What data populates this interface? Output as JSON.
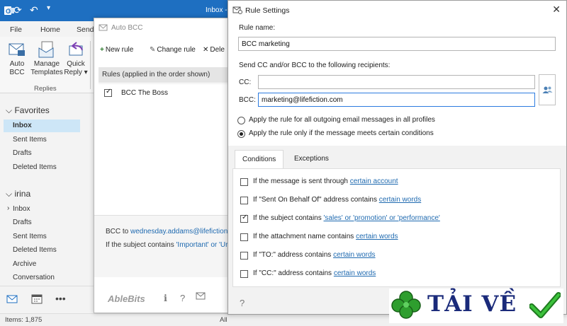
{
  "outlook": {
    "title": "Inbox -",
    "ribbon_tabs": [
      "File",
      "Home",
      "Send"
    ],
    "ribbon_buttons": {
      "auto_bcc": [
        "Auto",
        "BCC"
      ],
      "manage_templates": [
        "Manage",
        "Templates"
      ],
      "quick_reply": [
        "Quick",
        "Reply ▾"
      ]
    },
    "ribbon_group": "Replies",
    "favorites": {
      "header": "Favorites",
      "items": [
        "Inbox",
        "Sent Items",
        "Drafts",
        "Deleted Items"
      ]
    },
    "account": {
      "header": "irina",
      "items": [
        "Inbox",
        "Drafts",
        "Sent Items",
        "Deleted Items",
        "Archive",
        "Conversation"
      ]
    },
    "status": {
      "items": "Items: 1,875",
      "all": "All"
    }
  },
  "auto_bcc": {
    "title": "Auto BCC",
    "toolbar": {
      "new_rule": "New rule",
      "change_rule": "Change rule",
      "delete": "Dele"
    },
    "rules_header": "Rules (applied in the order shown)",
    "rules": [
      {
        "name": "BCC The Boss",
        "checked": true
      }
    ],
    "summary": {
      "line1_prefix": "BCC to ",
      "line1_value": "wednesday.addams@lifefiction.c",
      "line2_prefix": "If the subject contains ",
      "line2_value": "'Important' or 'Ur"
    },
    "logo": "AbleBits"
  },
  "rule_settings": {
    "title": "Rule Settings",
    "rule_name_label": "Rule name:",
    "rule_name_value": "BCC marketing",
    "send_label": "Send CC and/or BCC to the following recipients:",
    "cc_label": "CC:",
    "cc_value": "",
    "bcc_label": "BCC:",
    "bcc_value": "marketing@lifefiction.com",
    "radio_all": "Apply the rule for all outgoing email messages in all profiles",
    "radio_conditions": "Apply the rule only if the message meets certain conditions",
    "tabs": {
      "conditions": "Conditions",
      "exceptions": "Exceptions"
    },
    "conditions": [
      {
        "prefix": "If the message is sent through ",
        "link": "certain account",
        "checked": false
      },
      {
        "prefix": "If \"Sent On Behalf Of\" address contains ",
        "link": "certain words",
        "checked": false
      },
      {
        "prefix": "If the subject contains ",
        "link": "'sales' or 'promotion' or 'performance'",
        "checked": true
      },
      {
        "prefix": "If the attachment name contains ",
        "link": "certain words",
        "checked": false
      },
      {
        "prefix": "If \"TO:\" address contains ",
        "link": "certain words",
        "checked": false
      },
      {
        "prefix": "If \"CC:\" address contains ",
        "link": "certain words",
        "checked": false
      }
    ]
  },
  "watermark": {
    "text": "TẢI VỀ"
  },
  "colors": {
    "title_bar": "#1e6fc1",
    "accent": "#2c7be0",
    "link": "#1f6ab0",
    "selection": "#cde6f7"
  }
}
